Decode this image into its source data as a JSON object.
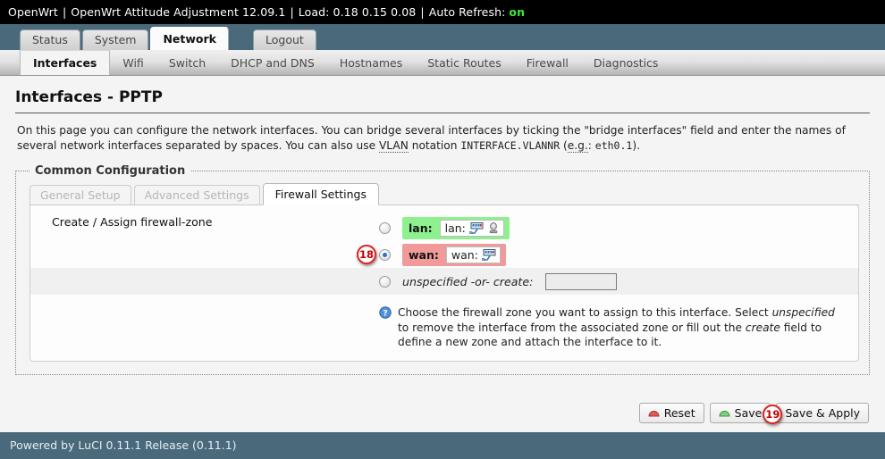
{
  "topbar": {
    "host": "OpenWrt",
    "firmware": "OpenWrt Attitude Adjustment 12.09.1",
    "load_label": "Load: 0.18 0.15 0.08",
    "refresh_label": "Auto Refresh:",
    "refresh_state": "on",
    "separator": "|"
  },
  "main_tabs": [
    {
      "label": "Status",
      "active": false
    },
    {
      "label": "System",
      "active": false
    },
    {
      "label": "Network",
      "active": true
    },
    {
      "label": "Logout",
      "active": false
    }
  ],
  "sub_tabs": [
    {
      "label": "Interfaces",
      "active": true
    },
    {
      "label": "Wifi",
      "active": false
    },
    {
      "label": "Switch",
      "active": false
    },
    {
      "label": "DHCP and DNS",
      "active": false
    },
    {
      "label": "Hostnames",
      "active": false
    },
    {
      "label": "Static Routes",
      "active": false
    },
    {
      "label": "Firewall",
      "active": false
    },
    {
      "label": "Diagnostics",
      "active": false
    }
  ],
  "page": {
    "title": "Interfaces - PPTP",
    "desc_1": "On this page you can configure the network interfaces. You can bridge several interfaces by ticking the \"bridge interfaces\" field and enter the names of several network interfaces separated by spaces. You can also use ",
    "desc_vlan": "VLAN",
    "desc_2": " notation ",
    "desc_code_1": "INTERFACE.VLANNR",
    "desc_3": " (",
    "desc_eg": "e.g.",
    "desc_4": ": ",
    "desc_code_2": "eth0.1",
    "desc_5": ")."
  },
  "fieldset": {
    "legend": "Common Configuration",
    "inner_tabs": [
      {
        "label": "General Setup",
        "active": false,
        "disabled": true
      },
      {
        "label": "Advanced Settings",
        "active": false,
        "disabled": true
      },
      {
        "label": "Firewall Settings",
        "active": true,
        "disabled": false
      }
    ],
    "field_label": "Create / Assign firewall-zone",
    "zones": [
      {
        "name": "lan:",
        "inner_text": "lan:",
        "icons": [
          "ethernet-icon",
          "wifi-icon"
        ],
        "color": "#8ef08e",
        "selected": false
      },
      {
        "name": "wan:",
        "inner_text": "wan:",
        "icons": [
          "ethernet-icon"
        ],
        "color": "#f09a9a",
        "selected": true
      }
    ],
    "unspecified": {
      "label": "unspecified -or- create:",
      "input_value": "",
      "selected": false
    },
    "help": {
      "icon": "help-circle-icon",
      "part_1": "Choose the firewall zone you want to assign to this interface. Select ",
      "em_1": "unspecified",
      "part_2": " to remove the interface from the associated zone or fill out the ",
      "em_2": "create",
      "part_3": " field to define a new zone and attach the interface to it."
    }
  },
  "actions": {
    "reset": "Reset",
    "save": "Save",
    "save_apply": "Save & Apply"
  },
  "markers": {
    "radio_wan": "18",
    "save_apply": "19"
  },
  "footer": {
    "text": "Powered by LuCI 0.11.1 Release (0.11.1)"
  }
}
